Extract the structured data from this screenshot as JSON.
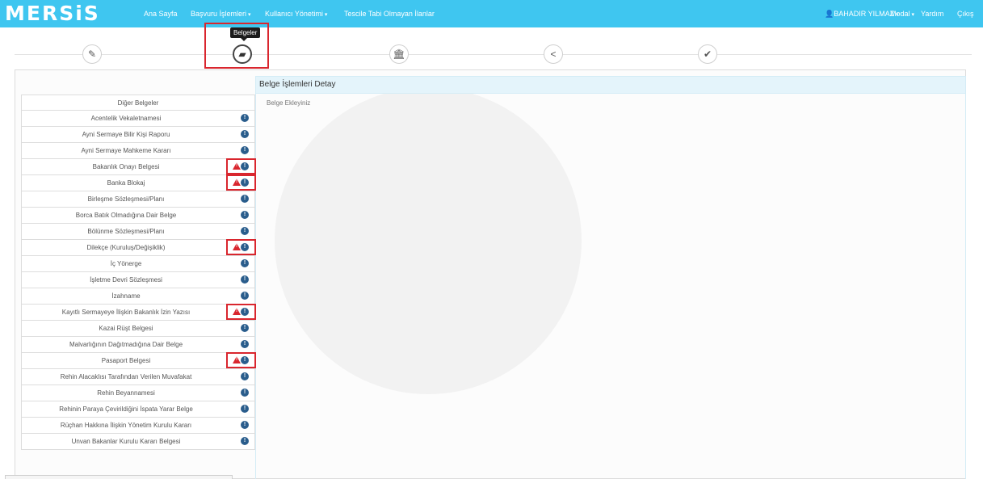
{
  "navbar": {
    "logo": "MERSiS",
    "links": [
      "Ana Sayfa",
      "Başvuru İşlemleri",
      "Kullanıcı Yönetimi",
      "Tescile Tabi Olmayan İlanlar"
    ],
    "user": "BAHADIR YILMAZ",
    "modal": "Modal",
    "help": "Yardım",
    "logout": "Çıkış"
  },
  "steps": {
    "tooltip": "Belgeler",
    "icons": [
      "pencil-icon",
      "folder-open-icon",
      "bank-icon",
      "share-icon",
      "check-icon"
    ]
  },
  "detail": {
    "title": "Belge İşlemleri Detay",
    "hint": "Belge Ekleyiniz"
  },
  "documents": {
    "header": "Diğer Belgeler",
    "items": [
      {
        "label": "Acentelik Vekaletnamesi",
        "warning": false
      },
      {
        "label": "Ayni Sermaye Bilir Kişi Raporu",
        "warning": false
      },
      {
        "label": "Ayni Sermaye Mahkeme Kararı",
        "warning": false
      },
      {
        "label": "Bakanlık Onayı Belgesi",
        "warning": true
      },
      {
        "label": "Banka Blokaj",
        "warning": true
      },
      {
        "label": "Birleşme Sözleşmesi/Planı",
        "warning": false
      },
      {
        "label": "Borca Batık Olmadığına Dair Belge",
        "warning": false
      },
      {
        "label": "Bölünme Sözleşmesi/Planı",
        "warning": false
      },
      {
        "label": "Dilekçe (Kuruluş/Değişiklik)",
        "warning": true
      },
      {
        "label": "İç Yönerge",
        "warning": false
      },
      {
        "label": "İşletme Devri Sözleşmesi",
        "warning": false
      },
      {
        "label": "İzahname",
        "warning": false
      },
      {
        "label": "Kayıtlı Sermayeye İlişkin Bakanlık İzin Yazısı",
        "warning": true
      },
      {
        "label": "Kazai Rüşt Belgesi",
        "warning": false
      },
      {
        "label": "Malvarlığının Dağıtmadığına Dair Belge",
        "warning": false
      },
      {
        "label": "Pasaport Belgesi",
        "warning": true
      },
      {
        "label": "Rehin Alacaklısı Tarafından Verilen Muvafakat",
        "warning": false
      },
      {
        "label": "Rehin Beyannamesi",
        "warning": false
      },
      {
        "label": "Rehinin Paraya Çevirildiğini İspata Yarar Belge",
        "warning": false
      },
      {
        "label": "Rüçhan Hakkına İlişkin Yönetim Kurulu Kararı",
        "warning": false
      },
      {
        "label": "Unvan Bakanlar Kurulu Kararı Belgesi",
        "warning": false
      }
    ]
  },
  "colors": {
    "navbar": "#3fc6f0",
    "highlight": "#d9262e",
    "info": "#2a5d8c"
  }
}
